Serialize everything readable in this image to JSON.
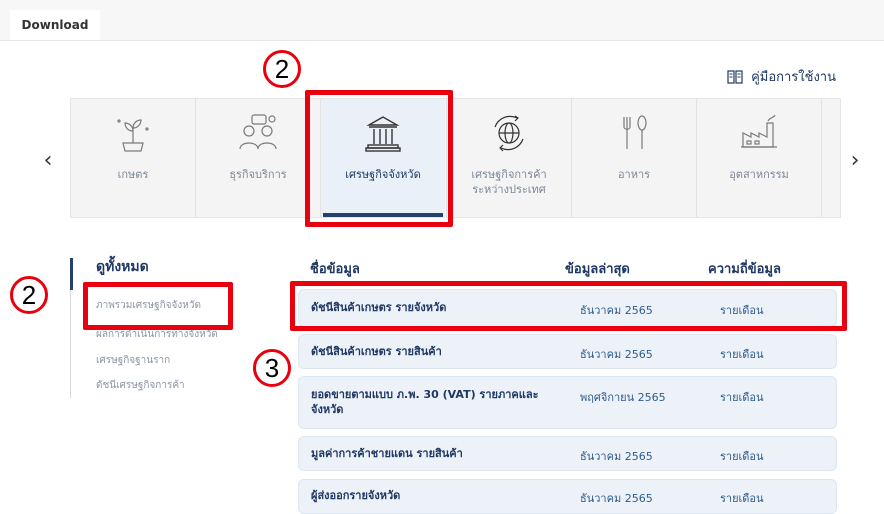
{
  "tabs": {
    "download": "Download"
  },
  "manual": {
    "label": "คู่มือการใช้งาน",
    "icon": "book-icon"
  },
  "carousel": {
    "prev_icon": "chevron-left-icon",
    "next_icon": "chevron-right-icon",
    "categories": [
      {
        "label": "เกษตร",
        "icon": "plant-icon",
        "active": false
      },
      {
        "label": "ธุรกิจบริการ",
        "icon": "people-chat-icon",
        "active": false
      },
      {
        "label": "เศรษฐกิจจังหวัด",
        "icon": "government-building-icon",
        "active": true
      },
      {
        "label": "เศรษฐกิจการค้า\nระหว่างประเทศ",
        "icon": "globe-trade-icon",
        "active": false
      },
      {
        "label": "อาหาร",
        "icon": "fork-spoon-icon",
        "active": false
      },
      {
        "label": "อุตสาหกรรม",
        "icon": "factory-icon",
        "active": false
      }
    ]
  },
  "sidebar": {
    "title": "ดูทั้งหมด",
    "items": [
      "ภาพรวมเศรษฐกิจจังหวัด",
      "ผลการดำเนินการทางจังหวัด",
      "เศรษฐกิจฐานราก",
      "ดัชนีเศรษฐกิจการค้า"
    ]
  },
  "table": {
    "headers": {
      "name": "ชื่อข้อมูล",
      "latest": "ข้อมูลล่าสุด",
      "frequency": "ความถี่ข้อมูล"
    },
    "rows": [
      {
        "name": "ดัชนีสินค้าเกษตร รายจังหวัด",
        "latest": "ธันวาคม 2565",
        "frequency": "รายเดือน"
      },
      {
        "name": "ดัชนีสินค้าเกษตร รายสินค้า",
        "latest": "ธันวาคม 2565",
        "frequency": "รายเดือน"
      },
      {
        "name": "ยอดขายตามแบบ ภ.พ. 30 (VAT) รายภาคและจังหวัด",
        "latest": "พฤศจิกายน 2565",
        "frequency": "รายเดือน"
      },
      {
        "name": "มูลค่าการค้าชายแดน รายสินค้า",
        "latest": "ธันวาคม 2565",
        "frequency": "รายเดือน"
      },
      {
        "name": "ผู้ส่งออกรายจังหวัด",
        "latest": "ธันวาคม 2565",
        "frequency": "รายเดือน"
      }
    ]
  },
  "annotations": {
    "step_a": "2",
    "step_b": "2",
    "step_c": "3",
    "highlight_color": "#e8000e"
  }
}
